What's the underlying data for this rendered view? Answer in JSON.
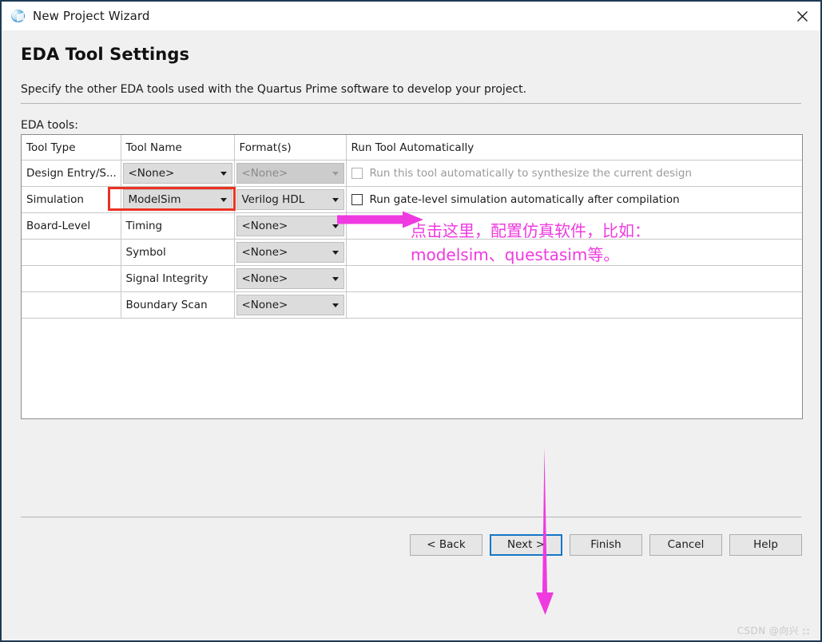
{
  "window": {
    "title": "New Project Wizard",
    "icon": "quartus-globe-icon",
    "close_label": "✕"
  },
  "page": {
    "title": "EDA Tool Settings",
    "description": "Specify the other EDA tools used with the Quartus Prime software to develop your project.",
    "section_label": "EDA tools:"
  },
  "table": {
    "headers": [
      "Tool Type",
      "Tool Name",
      "Format(s)",
      "Run Tool Automatically"
    ],
    "rows": [
      {
        "tool_type": "Design Entry/S...",
        "tool_name": {
          "kind": "combo",
          "value": "<None>",
          "disabled": false
        },
        "format": {
          "kind": "combo",
          "value": "<None>",
          "disabled": true
        },
        "auto": {
          "kind": "checkbox",
          "label": "Run this tool automatically to synthesize the current design",
          "checked": false,
          "disabled": true
        }
      },
      {
        "tool_type": "Simulation",
        "tool_name": {
          "kind": "combo",
          "value": "ModelSim",
          "disabled": false
        },
        "format": {
          "kind": "combo",
          "value": "Verilog HDL",
          "disabled": false
        },
        "auto": {
          "kind": "checkbox",
          "label": "Run gate-level simulation automatically after compilation",
          "checked": false,
          "disabled": false
        }
      },
      {
        "tool_type": "Board-Level",
        "tool_name": {
          "kind": "text",
          "value": "Timing"
        },
        "format": {
          "kind": "combo",
          "value": "<None>",
          "disabled": false
        },
        "auto": {
          "kind": "empty",
          "label": ""
        }
      },
      {
        "tool_type": "",
        "tool_name": {
          "kind": "text",
          "value": "Symbol"
        },
        "format": {
          "kind": "combo",
          "value": "<None>",
          "disabled": false
        },
        "auto": {
          "kind": "empty",
          "label": ""
        }
      },
      {
        "tool_type": "",
        "tool_name": {
          "kind": "text",
          "value": "Signal Integrity"
        },
        "format": {
          "kind": "combo",
          "value": "<None>",
          "disabled": false
        },
        "auto": {
          "kind": "empty",
          "label": ""
        }
      },
      {
        "tool_type": "",
        "tool_name": {
          "kind": "text",
          "value": "Boundary Scan"
        },
        "format": {
          "kind": "combo",
          "value": "<None>",
          "disabled": false
        },
        "auto": {
          "kind": "empty",
          "label": ""
        }
      }
    ]
  },
  "annotations": {
    "highlight_color": "#ea3323",
    "arrow_color": "#ef3ae0",
    "text": "点击这里，配置仿真软件，比如：\nmodelsim、questasim等。"
  },
  "footer": {
    "buttons": [
      {
        "label": "< Back",
        "default": false
      },
      {
        "label": "Next >",
        "default": true
      },
      {
        "label": "Finish",
        "default": false
      },
      {
        "label": "Cancel",
        "default": false
      },
      {
        "label": "Help",
        "default": false
      }
    ],
    "watermark": "CSDN @向兴"
  }
}
